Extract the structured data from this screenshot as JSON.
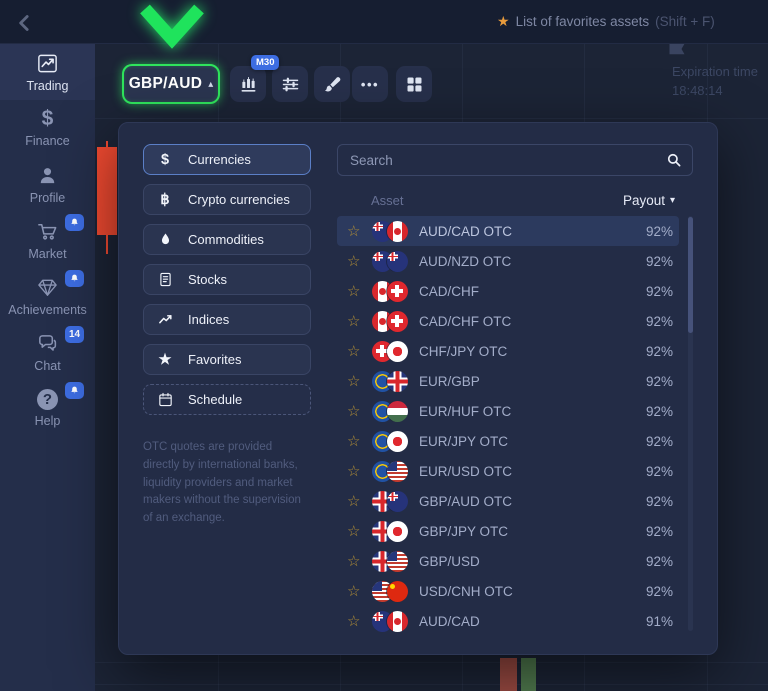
{
  "topbar": {
    "favorites_hint_text": "List of favorites assets",
    "favorites_hint_shortcut": "(Shift + F)"
  },
  "sidebar": {
    "items": [
      {
        "label": "Trading",
        "active": true
      },
      {
        "label": "Finance"
      },
      {
        "label": "Profile"
      },
      {
        "label": "Market",
        "badge": "bell"
      },
      {
        "label": "Achievements",
        "badge": "bell"
      },
      {
        "label": "Chat",
        "badge_count": "14"
      },
      {
        "label": "Help",
        "badge": "bell"
      }
    ]
  },
  "toolbar": {
    "asset_pair": "GBP/AUD",
    "timeframe_badge": "M30"
  },
  "chart": {
    "expiration_label": "Expiration time",
    "expiration_value": "18:48:14"
  },
  "asset_picker": {
    "categories": [
      {
        "label": "Currencies",
        "selected": true
      },
      {
        "label": "Crypto currencies"
      },
      {
        "label": "Commodities"
      },
      {
        "label": "Stocks"
      },
      {
        "label": "Indices"
      },
      {
        "label": "Favorites"
      },
      {
        "label": "Schedule"
      }
    ],
    "otc_note": "OTC quotes are provided directly by international banks, liquidity providers and market makers without the supervision of an exchange.",
    "search_placeholder": "Search",
    "columns": {
      "asset": "Asset",
      "payout": "Payout"
    },
    "assets": [
      {
        "name": "AUD/CAD OTC",
        "payout": "92%",
        "flag_base": "f-aud",
        "flag_quote": "f-cad",
        "state": "selected"
      },
      {
        "name": "AUD/NZD OTC",
        "payout": "92%",
        "flag_base": "f-aud",
        "flag_quote": "f-nzd"
      },
      {
        "name": "CAD/CHF",
        "payout": "92%",
        "flag_base": "f-cad",
        "flag_quote": "f-chf"
      },
      {
        "name": "CAD/CHF OTC",
        "payout": "92%",
        "flag_base": "f-cad",
        "flag_quote": "f-chf"
      },
      {
        "name": "CHF/JPY OTC",
        "payout": "92%",
        "flag_base": "f-chf",
        "flag_quote": "f-jpy"
      },
      {
        "name": "EUR/GBP",
        "payout": "92%",
        "flag_base": "f-eur",
        "flag_quote": "f-gbp"
      },
      {
        "name": "EUR/HUF OTC",
        "payout": "92%",
        "flag_base": "f-eur",
        "flag_quote": "f-huf"
      },
      {
        "name": "EUR/JPY OTC",
        "payout": "92%",
        "flag_base": "f-eur",
        "flag_quote": "f-jpy"
      },
      {
        "name": "EUR/USD OTC",
        "payout": "92%",
        "flag_base": "f-eur",
        "flag_quote": "f-usd"
      },
      {
        "name": "GBP/AUD OTC",
        "payout": "92%",
        "flag_base": "f-gbp",
        "flag_quote": "f-aud"
      },
      {
        "name": "GBP/JPY OTC",
        "payout": "92%",
        "flag_base": "f-gbp",
        "flag_quote": "f-jpy"
      },
      {
        "name": "GBP/USD",
        "payout": "92%",
        "flag_base": "f-gbp",
        "flag_quote": "f-usd"
      },
      {
        "name": "USD/CNH OTC",
        "payout": "92%",
        "flag_base": "f-usd",
        "flag_quote": "f-cnh"
      },
      {
        "name": "AUD/CAD",
        "payout": "91%",
        "flag_base": "f-aud",
        "flag_quote": "f-cad"
      }
    ]
  },
  "icons": {
    "dollar": "$",
    "bitcoin": "฿",
    "star": "★",
    "star_outline": "☆",
    "caret_up": "▴",
    "caret_down": "▾",
    "more_dots": "•••",
    "question": "?"
  },
  "colors": {
    "accent_green": "#2fe45c",
    "badge_blue": "#3d6de2",
    "panel_bg": "#232c46",
    "topbar_bg": "#161e31",
    "sidebar_bg": "#242e4a",
    "chart_bg": "#1c2436",
    "selected_row": "#2c3a5e",
    "favorites_star_orange": "#e89b3c",
    "list_star_gold": "#b38f35",
    "candle_red_bright": "#f14a31",
    "candle_red_muted": "#9a4a42",
    "candle_green_muted": "#507a4e"
  }
}
